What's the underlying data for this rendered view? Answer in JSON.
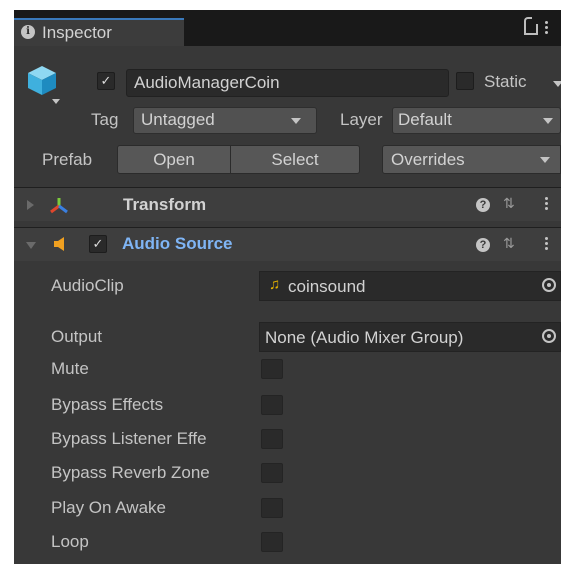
{
  "tab": {
    "label": "Inspector",
    "icon": "info-icon"
  },
  "gameobject": {
    "active": true,
    "name": "AudioManagerCoin",
    "static_label": "Static",
    "static_checked": false,
    "tag_label": "Tag",
    "tag_value": "Untagged",
    "layer_label": "Layer",
    "layer_value": "Default"
  },
  "prefab": {
    "label": "Prefab",
    "open_label": "Open",
    "select_label": "Select",
    "overrides_label": "Overrides"
  },
  "components": [
    {
      "title": "Transform",
      "expanded": false,
      "icon": "transform-icon"
    },
    {
      "title": "Audio Source",
      "expanded": true,
      "enabled": true,
      "icon": "audio-source-icon"
    }
  ],
  "audio_source": {
    "audioclip_label": "AudioClip",
    "audioclip_value": "coinsound",
    "output_label": "Output",
    "output_value": "None (Audio Mixer Group)",
    "checkbox_props": [
      {
        "label": "Mute",
        "checked": false
      },
      {
        "label": "Bypass Effects",
        "checked": false
      },
      {
        "label": "Bypass Listener Effe",
        "checked": false
      },
      {
        "label": "Bypass Reverb Zone",
        "checked": false
      },
      {
        "label": "Play On Awake",
        "checked": false
      },
      {
        "label": "Loop",
        "checked": false
      }
    ]
  },
  "colors": {
    "panel_bg": "#383838",
    "tab_accent": "#3a79bb",
    "component_title_active": "#7fb5f5",
    "audio_icon": "#f0a020",
    "clip_icon": "#e8b400"
  }
}
